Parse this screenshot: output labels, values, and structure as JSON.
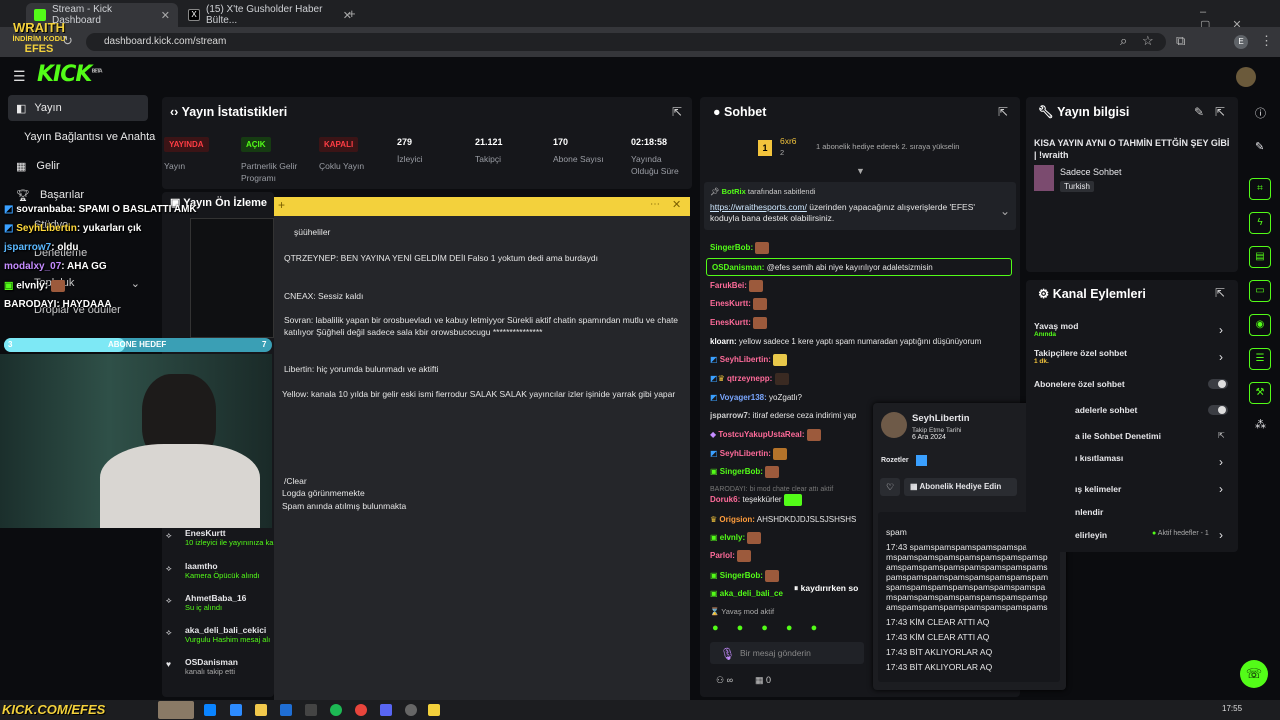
{
  "browser": {
    "tabs": [
      {
        "title": "Stream - Kick Dashboard"
      },
      {
        "title": "(15) X'te Gusholder Haber Bülte..."
      }
    ],
    "url": "dashboard.kick.com/stream",
    "profile_letter": "E"
  },
  "overlay_logo": {
    "line1": "WRAITH",
    "line2": "İNDİRİM KODU",
    "line3": "EFES"
  },
  "kick": {
    "logo": "KICK",
    "beta": "BETA"
  },
  "sidebar": {
    "items": [
      {
        "label": "Yayın"
      },
      {
        "label": "Yayın Bağlantısı ve Anahtarı"
      },
      {
        "label": "Gelir"
      },
      {
        "label": "Başarılar"
      },
      {
        "label": "Stüdyo"
      },
      {
        "label": "Denetleme"
      },
      {
        "label": "Topluluk"
      },
      {
        "label": "Droplar ve ödüller"
      }
    ]
  },
  "stream_overlay_chat": [
    {
      "user": "sovranbaba",
      "text": ": SPAMI O BASLATTI AMK"
    },
    {
      "user": "SeyhLibertin",
      "text": ": yukarları çık"
    },
    {
      "user": "jsparrow7",
      "text": ": oldu"
    },
    {
      "user": "modalxy_07",
      "text": ": AHA GG"
    },
    {
      "user": "elvnly",
      "text": ":"
    },
    {
      "user": "BARODAYI",
      "text": ": HAYDAAA"
    }
  ],
  "sub_goal": {
    "label": "ABONE HEDEF",
    "start": "3",
    "end": "7",
    "progress": 0.45
  },
  "stats": {
    "title": "Yayın İstatistikleri",
    "items": [
      {
        "badge": "YAYINDA",
        "label": "Yayın",
        "color": "#e8262b"
      },
      {
        "badge": "AÇIK",
        "label": "Partnerlik Gelir Programı",
        "color": "#53fc18"
      },
      {
        "badge": "KAPALI",
        "label": "Çoklu Yayın",
        "color": "#e8262b"
      },
      {
        "value": "279",
        "label": "İzleyici"
      },
      {
        "value": "21.121",
        "label": "Takipçi"
      },
      {
        "value": "170",
        "label": "Abone Sayısı"
      },
      {
        "value": "02:18:58",
        "label": "Yayında Olduğu Süre"
      }
    ]
  },
  "preview": {
    "title": "Yayın Ön İzleme"
  },
  "activity": [
    {
      "user": "EnesKurtt",
      "sub": "10 izleyici ile yayınınıza ka"
    },
    {
      "user": "laamtho",
      "sub": "Kamera Öpücük alındı"
    },
    {
      "user": "AhmetBaba_16",
      "sub": "Su iç alındı"
    },
    {
      "user": "aka_deli_bali_cekici",
      "sub": "Vurgulu Hashim mesaj alı"
    },
    {
      "user": "OSDanisman",
      "sub": "kanalı takip etti"
    }
  ],
  "notes": {
    "lines": [
      "şüüheliler",
      "QTRZEYNEP: BEN YAYINA YENİ GELDİM DEİl Falso 1 yoktum dedi ama burdaydı",
      "CNEAX: Sessiz kaldı",
      "Sovran: labalilik yapan bir orosbuevladı ve kabuy letmiyyor Sürekli aktif chatin spamından mutlu ve chate katılıyor Şüğheli değil sadece sala kbir orowsbucocugu ***************",
      "Libertin: hiç yorumda bulunmadı ve aktifti",
      "Yellow: kanala 10 yılda bir gelir eski ismi fierrodur SALAK SALAK yayıncılar izler işinide yarrak gibi yapar",
      "/Clear",
      "Logda görünmemekte",
      "Spam anında atılmış bulunmakta"
    ]
  },
  "chat": {
    "title": "Sohbet",
    "gifter": {
      "name": "6xr6",
      "count": "2",
      "rank": "1",
      "msg": "1 abonelik hediye ederek 2. sıraya yükselin"
    },
    "pinned": {
      "by": "BotRix",
      "by_suffix": "tarafından sabitlendi",
      "link": "https://wraithesports.com/",
      "text": "üzerinden yapacağınız alışverişlerde 'EFES' koduyla bana destek olabilirsiniz."
    },
    "messages": [
      {
        "user": "SingerBob:",
        "text": "",
        "color": "#53fc18"
      },
      {
        "user": "OSDanisman:",
        "text": "@efes semih abi niye kayırılıyor adaletsizmisin",
        "color": "#53fc18"
      },
      {
        "user": "FarukBei:",
        "text": "",
        "color": "#ff6b9a"
      },
      {
        "user": "EnesKurtt:",
        "text": "",
        "color": "#ff6b9a"
      },
      {
        "user": "EnesKurtt:",
        "text": "",
        "color": "#ff6b9a"
      },
      {
        "user": "kloarn:",
        "text": "yellow sadece 1 kere yaptı spam numaradan yaptığını düşünüyorum",
        "color": "#ffffff"
      },
      {
        "user": "SeyhLibertin:",
        "text": "",
        "color": "#ff6b9a"
      },
      {
        "user": "qtrzeynepp:",
        "text": "",
        "color": "#ff6b9a"
      },
      {
        "user": "Voyager138:",
        "text": "yoZgatlı?",
        "color": "#7aa7ff"
      },
      {
        "user": "jsparrow7:",
        "text": "itiraf ederse ceza indirimi yap",
        "color": "#cfcfcf"
      },
      {
        "user": "TostcuYakupUstaReal:",
        "text": "",
        "color": "#ff6b9a"
      },
      {
        "user": "SeyhLibertin:",
        "text": "",
        "color": "#ff6b9a"
      },
      {
        "user": "SingerBob:",
        "text": "",
        "color": "#53fc18"
      },
      {
        "user": "BARODAYI:",
        "text": "bi mod chate clear attı aktif",
        "color": "#777"
      },
      {
        "user": "Doruk6:",
        "text": "teşekkürler",
        "color": "#ff6b9a"
      },
      {
        "user": "Origsion:",
        "text": "AHSHDKDJDJSLSJSHSHS",
        "color": "#ff9d3c"
      },
      {
        "user": "elvnly:",
        "text": "",
        "color": "#53fc18"
      },
      {
        "user": "Parlol:",
        "text": "",
        "color": "#ff6b9a"
      },
      {
        "user": "SingerBob:",
        "text": "",
        "color": "#53fc18"
      },
      {
        "user": "aka_deli_bali_ce",
        "text": "",
        "color": "#53fc18"
      }
    ],
    "paused": "kaydırırken so",
    "slow_mode": "Yavaş mod aktif",
    "input_placeholder": "Bir mesaj gönderin",
    "footer_counts": [
      "∞",
      "0"
    ]
  },
  "user_card": {
    "name": "SeyhLibertin",
    "follow_label": "Takip Etme Tarihi",
    "follow_date": "6 Ara 2024",
    "badges_label": "Rozetler",
    "gift_button": "Abonelik Hediye Edin",
    "spam_word": "spam",
    "spam_time": "17:43",
    "spam_text": "spamspamspamspamspamspamspamspamspamspamspamspamspamspamspamspamspamspamspamspamspamspamspamspamspamspamspamspamspamspamspamspamspamspamspamspamspamspamspamspamspamspamspamspamspamspamspamspamspamspamspamspamspamspamspamspamspamspamspamspamspam",
    "log": [
      {
        "time": "17:43",
        "text": "KİM CLEAR ATTI AQ"
      },
      {
        "time": "17:43",
        "text": "KİM CLEAR ATTI AQ"
      },
      {
        "time": "17:43",
        "text": "BİT AKLIYORLAR AQ"
      },
      {
        "time": "17:43",
        "text": "BİT AKLIYORLAR AQ"
      }
    ]
  },
  "stream_info": {
    "title": "Yayın bilgisi",
    "stream_title": "KISA YAYIN AYNI O TAHMİN ETTĞİN ŞEY GİBİ | !wraith",
    "category": "Sadece Sohbet",
    "language": "Turkish"
  },
  "channel_actions": {
    "title": "Kanal Eylemleri",
    "items": [
      {
        "label": "Yavaş mod",
        "sub": "Anında"
      },
      {
        "label": "Takipçilere özel sohbet",
        "sub": "1 dk."
      },
      {
        "label": "Abonelere özel sohbet",
        "sub": ""
      },
      {
        "label": "adelerle sohbet",
        "sub": ""
      },
      {
        "label": "a ile Sohbet Denetimi",
        "sub": ""
      },
      {
        "label": "ı kısıtlaması",
        "sub": ""
      },
      {
        "label": "ış kelimeler",
        "sub": ""
      },
      {
        "label": "nlendir",
        "sub": ""
      },
      {
        "label": "elirleyin",
        "sub": ""
      }
    ],
    "goal_status": "Aktif hedefler - 1"
  },
  "overlay_bottom": "KICK.COM/EFES",
  "taskbar": {
    "time": "17:55"
  },
  "colors": {
    "kick_green": "#53fc18",
    "live_red": "#e8262b",
    "note_yellow": "#f3d13c"
  }
}
